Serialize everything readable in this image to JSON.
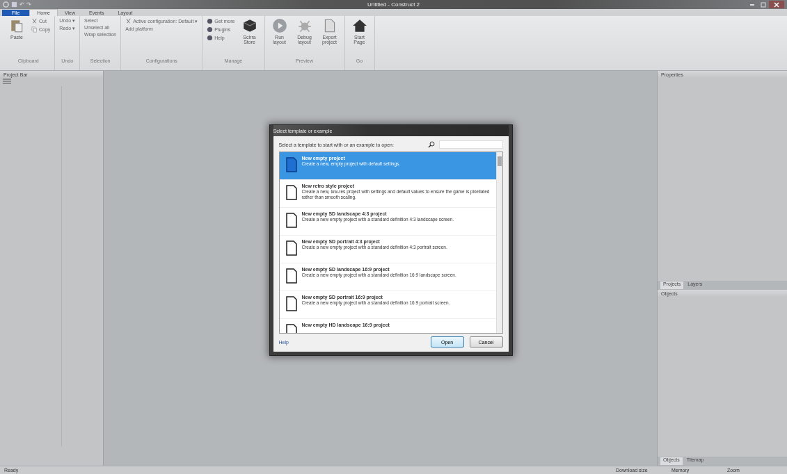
{
  "window": {
    "title": "Untitled - Construct 2"
  },
  "quick_access": [
    "↶",
    "↷"
  ],
  "ribbon_tabs": [
    {
      "label": "File",
      "kind": "file",
      "selected": false
    },
    {
      "label": "Home",
      "kind": "tab",
      "selected": true
    },
    {
      "label": "View",
      "kind": "tab",
      "selected": false
    },
    {
      "label": "Events",
      "kind": "tab",
      "selected": false
    },
    {
      "label": "Layout",
      "kind": "tab",
      "selected": false
    }
  ],
  "ribbon_groups": [
    {
      "name": "Clipboard",
      "items": [
        {
          "label": "Paste",
          "kind": "large"
        },
        {
          "label": "Cut",
          "kind": "small"
        },
        {
          "label": "Copy",
          "kind": "small"
        }
      ]
    },
    {
      "name": "Undo",
      "items": [
        {
          "label": "Undo ▾",
          "kind": "small"
        },
        {
          "label": "Redo ▾",
          "kind": "small"
        }
      ]
    },
    {
      "name": "Selection",
      "items": [
        {
          "label": "Select",
          "kind": "small"
        },
        {
          "label": "Unselect all",
          "kind": "small"
        },
        {
          "label": "Wrap selection",
          "kind": "small"
        }
      ]
    },
    {
      "name": "Configurations",
      "items": [
        {
          "label": "Active configuration: Default ▾",
          "kind": "small"
        },
        {
          "label": "Add platform",
          "kind": "small"
        }
      ]
    },
    {
      "name": "Manage",
      "items": [
        {
          "label": "Get more",
          "kind": "small"
        },
        {
          "label": "Plugins",
          "kind": "small"
        },
        {
          "label": "Help",
          "kind": "small"
        },
        {
          "label": "Scirra Store",
          "kind": "large"
        }
      ]
    },
    {
      "name": "Preview",
      "items": [
        {
          "label": "Run layout",
          "kind": "large"
        },
        {
          "label": "Debug layout",
          "kind": "large"
        },
        {
          "label": "Export project",
          "kind": "large"
        }
      ]
    },
    {
      "name": "Go",
      "items": [
        {
          "label": "Start Page",
          "kind": "large"
        }
      ]
    }
  ],
  "left_panel": {
    "title": "Project Bar"
  },
  "properties_panel": {
    "title": "Properties"
  },
  "layers_tabs": [
    {
      "label": "Projects",
      "selected": true
    },
    {
      "label": "Layers",
      "selected": false
    }
  ],
  "objects_panel": {
    "title": "Objects"
  },
  "objects_tabs": [
    {
      "label": "Objects",
      "selected": true
    },
    {
      "label": "Tilemap",
      "selected": false
    }
  ],
  "dialog": {
    "title": "Select template or example",
    "prompt": "Select a template to start with or an example to open:",
    "templates": [
      {
        "name": "New empty project",
        "description": "Create a new, empty project with default settings.",
        "selected": true
      },
      {
        "name": "New retro style project",
        "description": "Create a new, low-res project with settings and default values to ensure the game is pixellated rather than smooth scaling.",
        "selected": false
      },
      {
        "name": "New empty SD landscape 4:3 project",
        "description": "Create a new empty project with a standard definition 4:3 landscape screen.",
        "selected": false
      },
      {
        "name": "New empty SD portrait 4:3 project",
        "description": "Create a new empty project with a standard definition 4:3 portrait screen.",
        "selected": false
      },
      {
        "name": "New empty SD landscape 16:9 project",
        "description": "Create a new empty project with a standard definition 16:9 landscape screen.",
        "selected": false
      },
      {
        "name": "New empty SD portrait 16:9 project",
        "description": "Create a new empty project with a standard definition 16:9 portrait screen.",
        "selected": false
      },
      {
        "name": "New empty HD landscape 16:9 project",
        "selected": false
      }
    ],
    "help": "Help",
    "buttons": [
      "Open",
      "Cancel"
    ]
  },
  "status_bar": {
    "status": "Ready",
    "download": "Download size",
    "memory": "Memory",
    "zoom": "Zoom"
  }
}
